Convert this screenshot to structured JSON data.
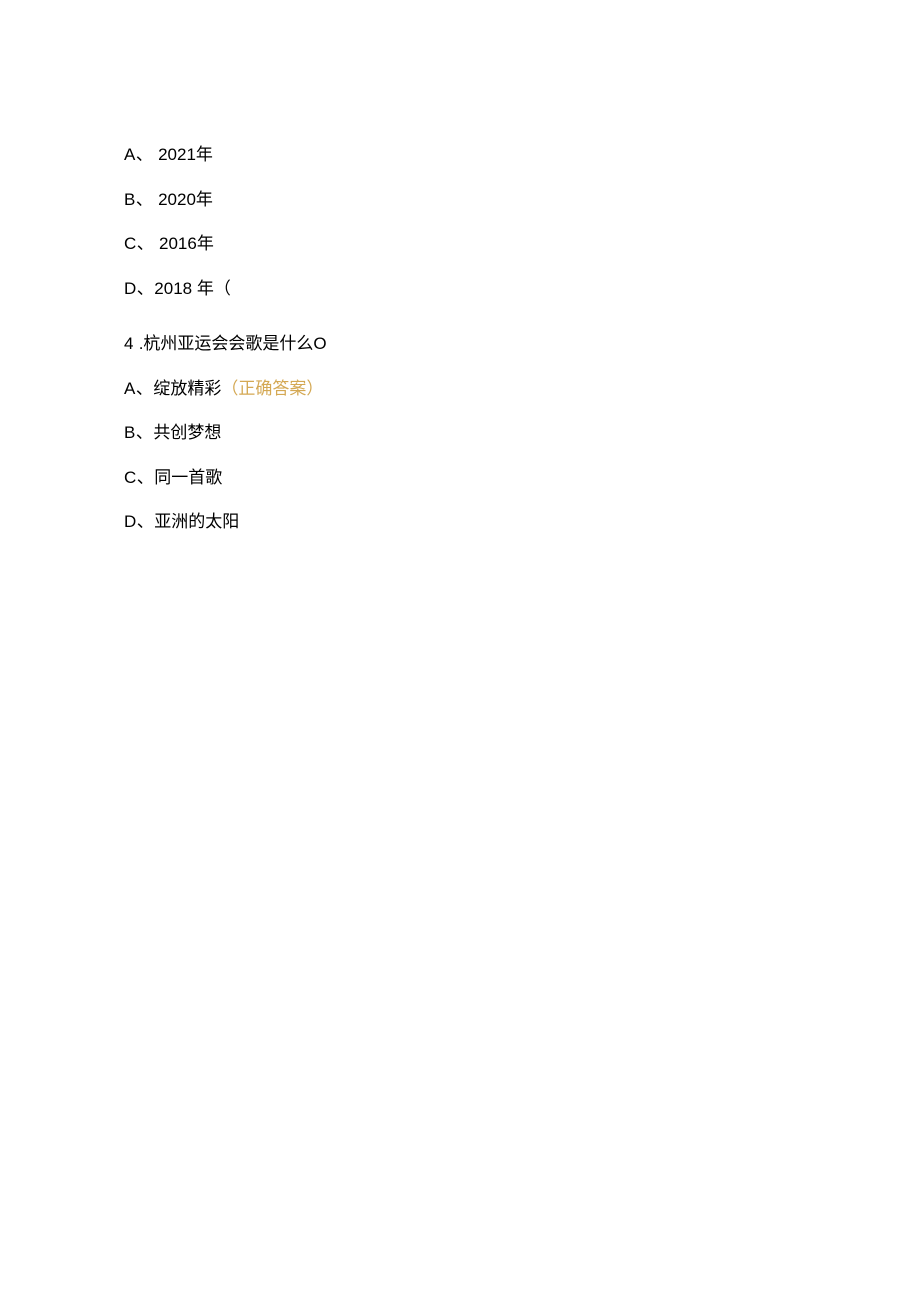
{
  "q3": {
    "optionA": {
      "label": "A、",
      "text": "2021年"
    },
    "optionB": {
      "label": "B、",
      "text": "2020年"
    },
    "optionC": {
      "label": "C、",
      "text": "2016年"
    },
    "optionD": {
      "label": "D、",
      "text": "2018 年（"
    }
  },
  "q4": {
    "number": "4",
    "question": "  .杭州亚运会会歌是什么O",
    "optionA": {
      "label": "A、",
      "text": "绽放精彩",
      "correctLabel": "（正确答案）"
    },
    "optionB": {
      "label": "B、",
      "text": "共创梦想"
    },
    "optionC": {
      "label": "C、",
      "text": "同一首歌"
    },
    "optionD": {
      "label": "D、",
      "text": "亚洲的太阳"
    }
  }
}
